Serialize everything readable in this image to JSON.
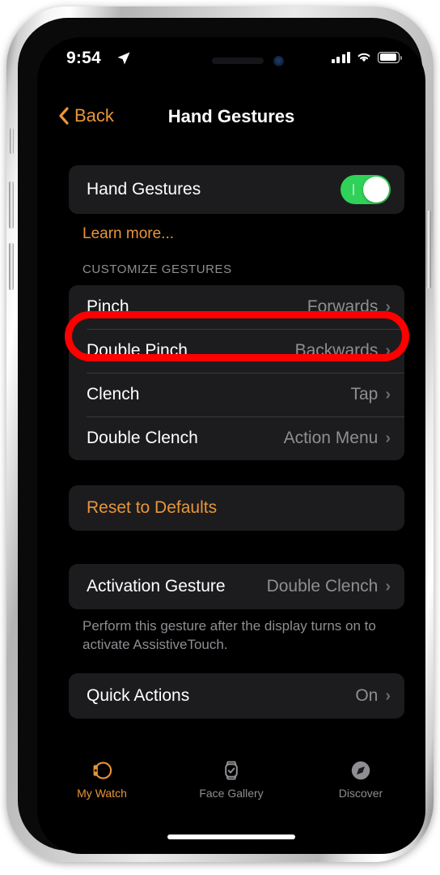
{
  "status_bar": {
    "time": "9:54",
    "location_icon": "location-arrow-icon",
    "cellular_icon": "cellular-bars-icon",
    "wifi_icon": "wifi-icon",
    "battery_icon": "battery-full-icon"
  },
  "nav_bar": {
    "back_label": "Back",
    "back_icon": "chevron-left-icon",
    "title": "Hand Gestures"
  },
  "main": {
    "master_toggle_row": {
      "label": "Hand Gestures",
      "toggle_state": "on",
      "toggle_color": "#30D158"
    },
    "learn_more_label": "Learn more...",
    "section_header": "CUSTOMIZE GESTURES",
    "gestures": [
      {
        "label": "Pinch",
        "value": "Forwards",
        "highlighted": true
      },
      {
        "label": "Double Pinch",
        "value": "Backwards",
        "highlighted": false
      },
      {
        "label": "Clench",
        "value": "Tap",
        "highlighted": false
      },
      {
        "label": "Double Clench",
        "value": "Action Menu",
        "highlighted": false
      }
    ],
    "reset_label": "Reset to Defaults",
    "activation_row": {
      "label": "Activation Gesture",
      "value": "Double Clench"
    },
    "activation_footer": "Perform this gesture after the display turns on to activate AssistiveTouch.",
    "quick_actions_row": {
      "label": "Quick Actions",
      "value": "On"
    },
    "chevron_glyph": "›"
  },
  "annotation": {
    "shape": "rounded-rectangle-outline",
    "color": "#FF0000",
    "targets": "Pinch"
  },
  "tab_bar": {
    "items": [
      {
        "label": "My Watch",
        "icon": "watch-side-icon",
        "active": true
      },
      {
        "label": "Face Gallery",
        "icon": "watch-face-icon",
        "active": false
      },
      {
        "label": "Discover",
        "icon": "compass-icon",
        "active": false
      }
    ],
    "active_color": "#E8953A",
    "inactive_color": "#8E8E93"
  }
}
